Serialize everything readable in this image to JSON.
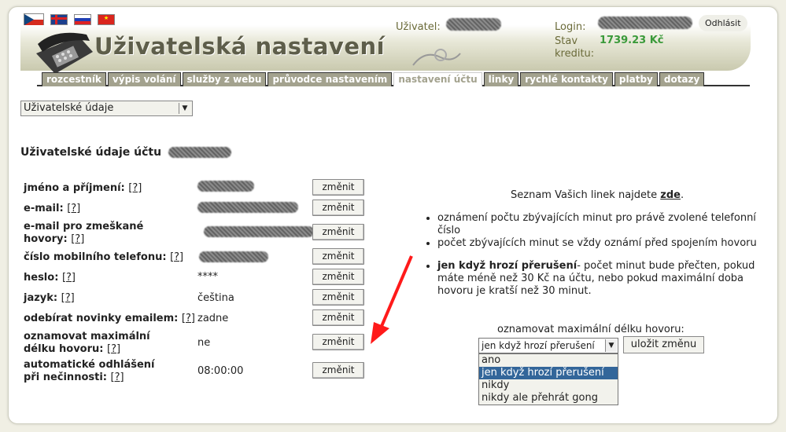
{
  "header": {
    "flags": [
      "cz",
      "gb",
      "ru",
      "vn"
    ],
    "title": "Uživatelská nastavení",
    "user_label": "Uživatel:",
    "login_label": "Login:",
    "credit_label_1": "Stav",
    "credit_label_2": "kreditu:",
    "credit_value": "1739.23 Kč",
    "logout": "Odhlásit"
  },
  "tabs": [
    "rozcestník",
    "výpis volání",
    "služby z webu",
    "průvodce nastavením",
    "nastavení účtu",
    "linky",
    "rychlé kontakty",
    "platby",
    "dotazy"
  ],
  "active_tab": 4,
  "section_select": {
    "value": "Uživatelské údaje"
  },
  "section_title": "Uživatelské údaje účtu",
  "rows": [
    {
      "label": "jméno a příjmení:",
      "help": "[?]",
      "value": "",
      "button": "změnit"
    },
    {
      "label": "e-mail:",
      "help": "[?]",
      "value": "",
      "button": "změnit"
    },
    {
      "label": "e-mail pro zmeškané hovory:",
      "help": "[?]",
      "value": "",
      "button": "změnit"
    },
    {
      "label": "číslo mobilního telefonu:",
      "help": "[?]",
      "value": "",
      "button": "změnit"
    },
    {
      "label": "heslo:",
      "help": "[?]",
      "value": "****",
      "button": "změnit"
    },
    {
      "label": "jazyk:",
      "help": "[?]",
      "value": "čeština",
      "button": "změnit"
    },
    {
      "label": "odebírat novinky emailem:",
      "help": "[?]",
      "value": "zadne",
      "button": "změnit"
    },
    {
      "label": "oznamovat maximální délku hovoru:",
      "help": "[?]",
      "value": "ne",
      "button": "změnit"
    },
    {
      "label": "automatické odhlášení při nečinnosti:",
      "help": "[?]",
      "value": "08:00:00",
      "button": "změnit"
    }
  ],
  "right": {
    "lines_prefix": "Seznam Vašich linek najdete",
    "lines_link": "zde",
    "lines_suffix": ".",
    "bullet1": "oznámení počtu zbývajících minut pro právě zvolené telefonní číslo",
    "bullet2": "počet zbývajících minut se vždy oznámí před spojením hovoru",
    "bullet3_bold": "jen když hrozí přerušení",
    "bullet3_rest": "- počet minut bude přečten, pokud máte méně než 30 Kč na účtu, nebo pokud maximální doba hovoru je kratší než 30 minut.",
    "dropdown_label": "oznamovat maximální délku hovoru:",
    "dropdown_value": "jen když hrozí přerušení",
    "save_button": "uložit změnu",
    "options": [
      "ano",
      "jen když hrozí přerušení",
      "nikdy",
      "nikdy ale přehrát gong"
    ],
    "selected_option": 1
  },
  "colors": {
    "tab_bg": "#a3a28e",
    "credit": "#3a9a3a",
    "arrow": "#ff1a1a",
    "selection": "#33669a"
  }
}
